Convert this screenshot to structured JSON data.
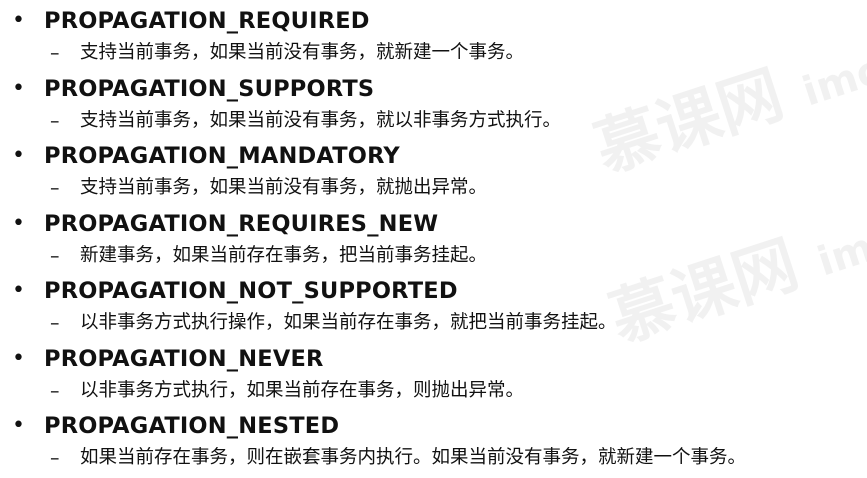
{
  "bullet_glyph": "•",
  "dash_glyph": "–",
  "watermark": {
    "text": "慕课网",
    "text2": "imooc.com"
  },
  "items": [
    {
      "term": "PROPAGATION_REQUIRED",
      "desc": "支持当前事务，如果当前没有事务，就新建一个事务。"
    },
    {
      "term": "PROPAGATION_SUPPORTS",
      "desc": "支持当前事务，如果当前没有事务，就以非事务方式执行。"
    },
    {
      "term": "PROPAGATION_MANDATORY",
      "desc": "支持当前事务，如果当前没有事务，就抛出异常。"
    },
    {
      "term": "PROPAGATION_REQUIRES_NEW",
      "desc": "新建事务，如果当前存在事务，把当前事务挂起。"
    },
    {
      "term": "PROPAGATION_NOT_SUPPORTED",
      "desc": "以非事务方式执行操作，如果当前存在事务，就把当前事务挂起。"
    },
    {
      "term": "PROPAGATION_NEVER",
      "desc": "以非事务方式执行，如果当前存在事务，则抛出异常。"
    },
    {
      "term": "PROPAGATION_NESTED",
      "desc": "如果当前存在事务，则在嵌套事务内执行。如果当前没有事务，就新建一个事务。"
    }
  ]
}
